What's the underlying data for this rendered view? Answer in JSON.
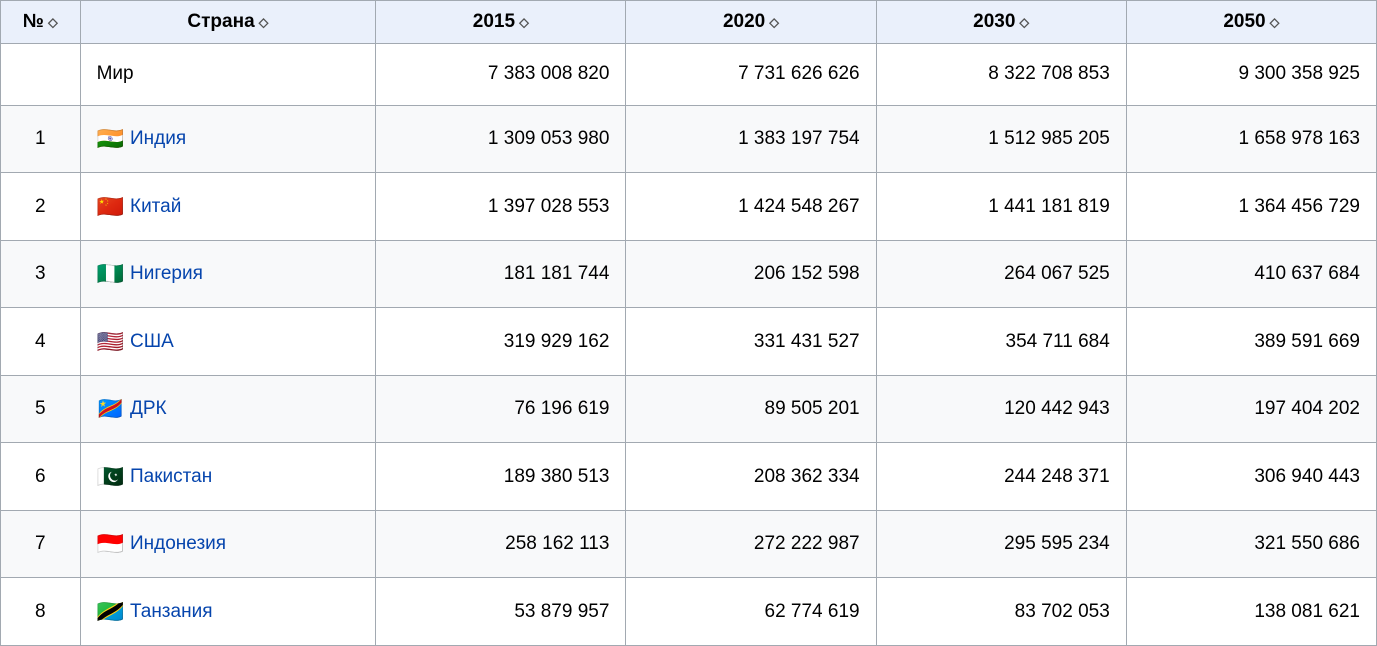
{
  "table": {
    "headers": [
      {
        "label": "№",
        "sort": true,
        "key": "num"
      },
      {
        "label": "Страна",
        "sort": true,
        "key": "country"
      },
      {
        "label": "2015",
        "sort": true,
        "key": "y2015"
      },
      {
        "label": "2020",
        "sort": true,
        "key": "y2020"
      },
      {
        "label": "2030",
        "sort": true,
        "key": "y2030"
      },
      {
        "label": "2050",
        "sort": true,
        "key": "y2050"
      }
    ],
    "rows": [
      {
        "num": "",
        "country": "Мир",
        "flag": "",
        "link": false,
        "y2015": "7 383 008 820",
        "y2020": "7 731 626 626",
        "y2030": "8 322 708 853",
        "y2050": "9 300 358 925",
        "world": true
      },
      {
        "num": "1",
        "country": "Индия",
        "flag": "🇮🇳",
        "link": true,
        "y2015": "1 309 053 980",
        "y2020": "1 383 197 754",
        "y2030": "1 512 985 205",
        "y2050": "1 658 978 163",
        "world": false
      },
      {
        "num": "2",
        "country": "Китай",
        "flag": "🇨🇳",
        "link": true,
        "y2015": "1 397 028 553",
        "y2020": "1 424 548 267",
        "y2030": "1 441 181 819",
        "y2050": "1 364 456 729",
        "world": false
      },
      {
        "num": "3",
        "country": "Нигерия",
        "flag": "🇳🇬",
        "link": true,
        "y2015": "181 181 744",
        "y2020": "206 152 598",
        "y2030": "264 067 525",
        "y2050": "410 637 684",
        "world": false
      },
      {
        "num": "4",
        "country": "США",
        "flag": "🇺🇸",
        "link": true,
        "y2015": "319 929 162",
        "y2020": "331 431 527",
        "y2030": "354 711 684",
        "y2050": "389 591 669",
        "world": false
      },
      {
        "num": "5",
        "country": "ДРК",
        "flag": "🇨🇩",
        "link": true,
        "y2015": "76 196 619",
        "y2020": "89 505 201",
        "y2030": "120 442 943",
        "y2050": "197 404 202",
        "world": false
      },
      {
        "num": "6",
        "country": "Пакистан",
        "flag": "🇵🇰",
        "link": true,
        "y2015": "189 380 513",
        "y2020": "208 362 334",
        "y2030": "244 248 371",
        "y2050": "306 940 443",
        "world": false
      },
      {
        "num": "7",
        "country": "Индонезия",
        "flag": "🇮🇩",
        "link": true,
        "y2015": "258 162 113",
        "y2020": "272 222 987",
        "y2030": "295 595 234",
        "y2050": "321 550 686",
        "world": false
      },
      {
        "num": "8",
        "country": "Танзания",
        "flag": "🇹🇿",
        "link": true,
        "y2015": "53 879 957",
        "y2020": "62 774 619",
        "y2030": "83 702 053",
        "y2050": "138 081 621",
        "world": false
      }
    ]
  }
}
